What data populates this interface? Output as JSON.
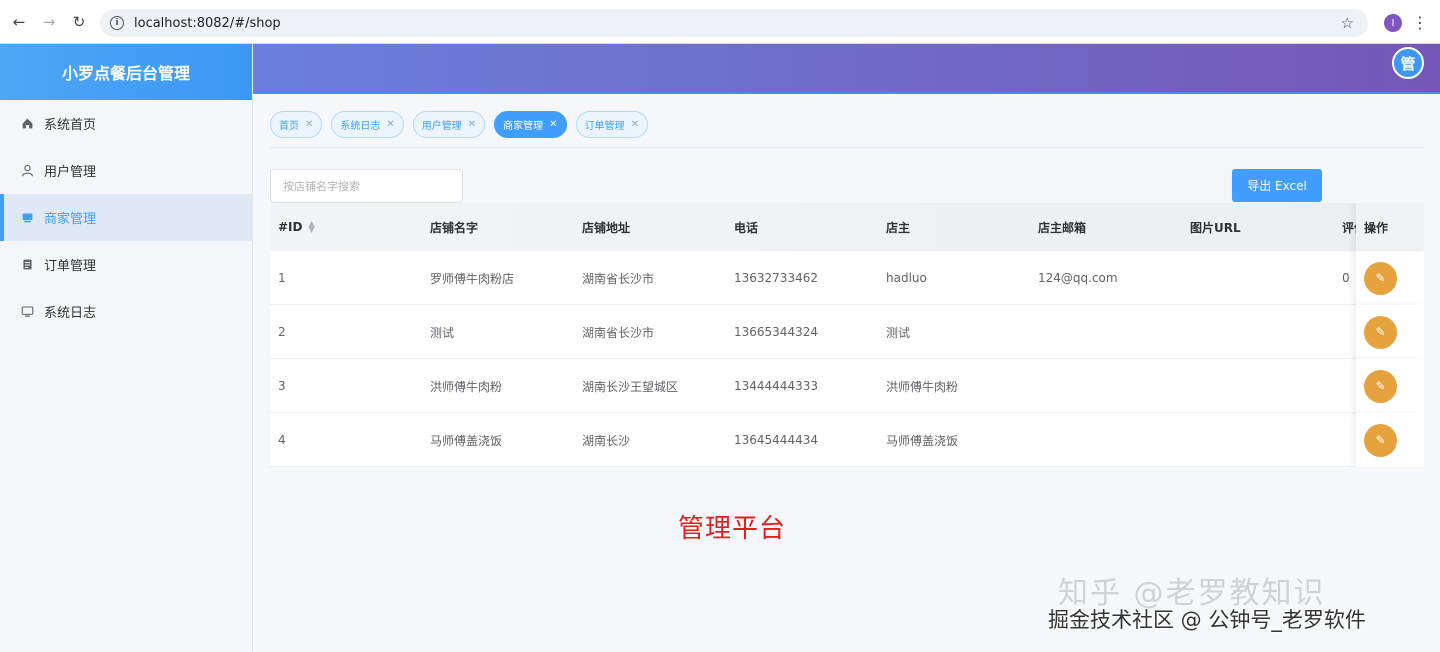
{
  "browser": {
    "url": "localhost:8082/#/shop",
    "profile_initial": "I"
  },
  "sidebar": {
    "title": "小罗点餐后台管理",
    "items": [
      {
        "label": "系统首页",
        "icon": "home-icon",
        "active": false
      },
      {
        "label": "用户管理",
        "icon": "user-icon",
        "active": false
      },
      {
        "label": "商家管理",
        "icon": "shop-icon",
        "active": true
      },
      {
        "label": "订单管理",
        "icon": "order-icon",
        "active": false
      },
      {
        "label": "系统日志",
        "icon": "monitor-icon",
        "active": false
      }
    ]
  },
  "header": {
    "avatar_text": "管"
  },
  "tabs": [
    {
      "label": "首页",
      "active": false
    },
    {
      "label": "系统日志",
      "active": false
    },
    {
      "label": "用户管理",
      "active": false
    },
    {
      "label": "商家管理",
      "active": true
    },
    {
      "label": "订单管理",
      "active": false
    }
  ],
  "toolbar": {
    "search_placeholder": "按店铺名字搜索",
    "export_label": "导出 Excel"
  },
  "table": {
    "columns": [
      "#ID",
      "店铺名字",
      "店铺地址",
      "电话",
      "店主",
      "店主邮箱",
      "图片URL",
      "评价",
      "操作"
    ],
    "rows": [
      [
        "1",
        "罗师傅牛肉粉店",
        "湖南省长沙市",
        "13632733462",
        "hadluo",
        "124@qq.com",
        "",
        "0"
      ],
      [
        "2",
        "测试",
        "湖南省长沙市",
        "13665344324",
        "测试",
        "",
        "",
        ""
      ],
      [
        "3",
        "洪师傅牛肉粉",
        "湖南长沙王望城区",
        "13444444333",
        "洪师傅牛肉粉",
        "",
        "",
        ""
      ],
      [
        "4",
        "马师傅盖浇饭",
        "湖南长沙",
        "13645444434",
        "马师傅盖浇饭",
        "",
        "",
        ""
      ]
    ]
  },
  "overlay": {
    "platform_title": "管理平台",
    "watermark_1": "知乎 @老罗教知识",
    "watermark_2": "掘金技术社区 @ 公钟号_老罗软件"
  },
  "colors": {
    "primary": "#409eff",
    "warning": "#e6a23c",
    "title_red": "#e02020"
  }
}
